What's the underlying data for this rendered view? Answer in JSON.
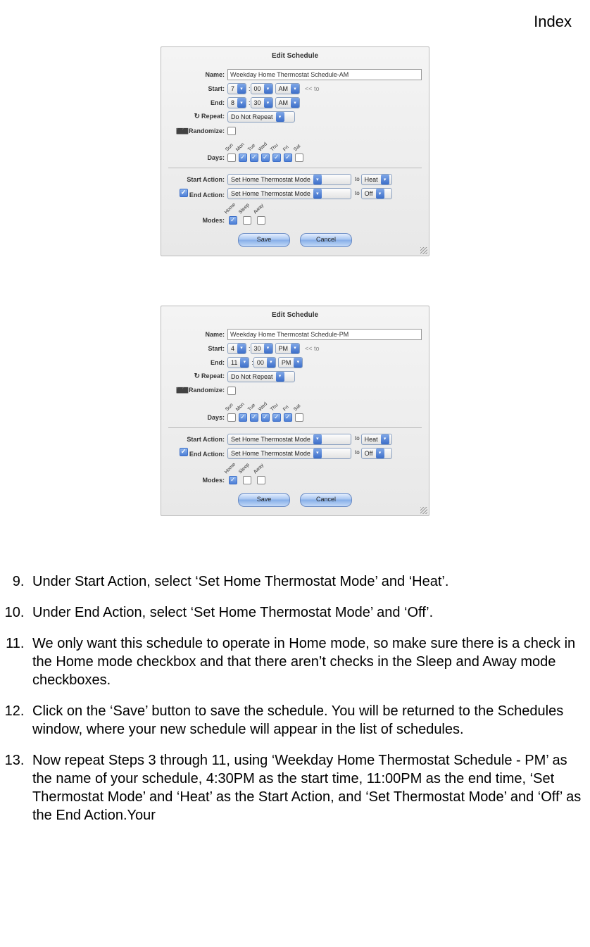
{
  "header": {
    "index_label": "Index"
  },
  "panel1": {
    "title": "Edit Schedule",
    "name_label": "Name:",
    "name_value": "Weekday Home Thermostat Schedule-AM",
    "start_label": "Start:",
    "start_hour": "7",
    "start_min": "00",
    "start_ampm": "AM",
    "start_hint": "<< to",
    "end_label": "End:",
    "end_hour": "8",
    "end_min": "30",
    "end_ampm": "AM",
    "repeat_label": "Repeat:",
    "repeat_value": "Do Not Repeat",
    "randomize_label": "Randomize:",
    "days_label": "Days:",
    "days": [
      "Sun",
      "Mon",
      "Tue",
      "Wed",
      "Thu",
      "Fri",
      "Sat"
    ],
    "days_checked": [
      false,
      true,
      true,
      true,
      true,
      true,
      false
    ],
    "start_action_label": "Start Action:",
    "start_action_select": "Set Home Thermostat Mode",
    "start_action_to": "to",
    "start_action_value": "Heat",
    "end_action_label": "End Action:",
    "end_action_select": "Set Home Thermostat Mode",
    "end_action_to": "to",
    "end_action_value": "Off",
    "modes_label": "Modes:",
    "modes": [
      "Home",
      "Sleep",
      "Away"
    ],
    "modes_checked": [
      true,
      false,
      false
    ],
    "save_label": "Save",
    "cancel_label": "Cancel"
  },
  "panel2": {
    "title": "Edit Schedule",
    "name_label": "Name:",
    "name_value": "Weekday Home Thermostat Schedule-PM",
    "start_label": "Start:",
    "start_hour": "4",
    "start_min": "30",
    "start_ampm": "PM",
    "start_hint": "<< to",
    "end_label": "End:",
    "end_hour": "11",
    "end_min": "00",
    "end_ampm": "PM",
    "repeat_label": "Repeat:",
    "repeat_value": "Do Not Repeat",
    "randomize_label": "Randomize:",
    "days_label": "Days:",
    "days": [
      "Sun",
      "Mon",
      "Tue",
      "Wed",
      "Thu",
      "Fri",
      "Sat"
    ],
    "days_checked": [
      false,
      true,
      true,
      true,
      true,
      true,
      false
    ],
    "start_action_label": "Start Action:",
    "start_action_select": "Set Home Thermostat Mode",
    "start_action_to": "to",
    "start_action_value": "Heat",
    "end_action_label": "End Action:",
    "end_action_select": "Set Home Thermostat Mode",
    "end_action_to": "to",
    "end_action_value": "Off",
    "modes_label": "Modes:",
    "modes": [
      "Home",
      "Sleep",
      "Away"
    ],
    "modes_checked": [
      true,
      false,
      false
    ],
    "save_label": "Save",
    "cancel_label": "Cancel"
  },
  "instructions": {
    "start": 9,
    "items": [
      "Under Start Action, select ‘Set Home Thermostat Mode’ and ‘Heat’.",
      "Under End Action, select ‘Set Home Thermostat Mode’ and ‘Off’.",
      "We only want this schedule to operate in Home mode, so make sure there is a check in the Home mode checkbox and that there aren’t checks in the Sleep and Away mode checkboxes.",
      "Click on the ‘Save’ button to save the schedule. You will be returned to the Schedules window, where your new schedule will appear in the list of schedules.",
      "Now repeat Steps 3 through 11, using ‘Weekday Home Thermostat Schedule - PM’ as the name of your schedule, 4:30PM as the start time, 11:00PM as the end time, ‘Set Thermostat Mode’ and ‘Heat’ as the Start Action, and ‘Set Thermostat Mode’ and ‘Off’ as the End Action.Your"
    ]
  }
}
